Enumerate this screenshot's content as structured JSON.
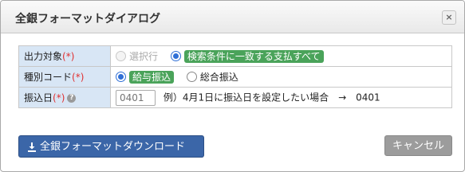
{
  "dialog": {
    "title": "全銀フォーマットダイアログ",
    "close_label": "×"
  },
  "form": {
    "required_mark": "(*)",
    "target": {
      "label": "出力対象",
      "options": [
        {
          "label": "選択行",
          "checked": false,
          "disabled": true
        },
        {
          "label": "検索条件に一致する支払すべて",
          "checked": true,
          "disabled": false
        }
      ]
    },
    "type": {
      "label": "種別コード",
      "options": [
        {
          "label": "給与振込",
          "checked": true
        },
        {
          "label": "総合振込",
          "checked": false
        }
      ]
    },
    "transfer_date": {
      "label": "振込日",
      "help_icon": "question-circle-icon",
      "placeholder": "0401",
      "hint": "例）4月1日に振込日を設定したい場合　→　0401"
    }
  },
  "buttons": {
    "download_label": "全銀フォーマットダウンロード",
    "download_icon": "download-icon",
    "cancel_label": "キャンセル"
  },
  "colors": {
    "label_bg": "#d8e6f5",
    "required": "#e03030",
    "selected_tag": "#4aa35a",
    "primary": "#3b66a8",
    "cancel": "#9c9c9c"
  }
}
